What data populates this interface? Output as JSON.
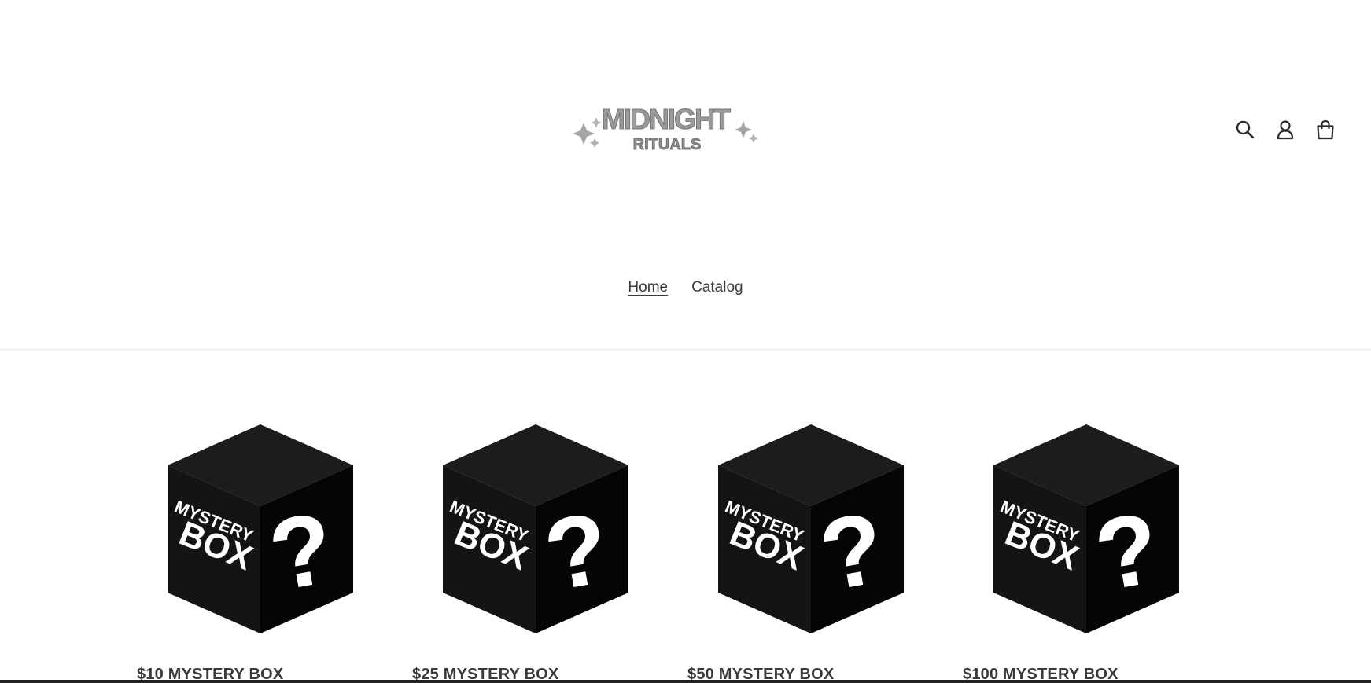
{
  "header": {
    "logo_text_top": "MIDNIGHT",
    "logo_text_bottom": "RITUALS",
    "icons": [
      "search-icon",
      "account-icon",
      "cart-icon"
    ]
  },
  "nav": {
    "items": [
      {
        "label": "Home",
        "active": true
      },
      {
        "label": "Catalog",
        "active": false
      }
    ]
  },
  "products": [
    {
      "title": "$10 MYSTERY BOX",
      "box_text_1": "MYSTERY",
      "box_text_2": "BOX",
      "box_symbol": "?"
    },
    {
      "title": "$25 MYSTERY BOX",
      "box_text_1": "MYSTERY",
      "box_text_2": "BOX",
      "box_symbol": "?"
    },
    {
      "title": "$50 MYSTERY BOX",
      "box_text_1": "MYSTERY",
      "box_text_2": "BOX",
      "box_symbol": "?"
    },
    {
      "title": "$100 MYSTERY BOX",
      "box_text_1": "MYSTERY",
      "box_text_2": "BOX",
      "box_symbol": "?"
    }
  ],
  "colors": {
    "text": "#3a3a3a",
    "box_top": "#1c1c1c",
    "box_left": "#141414",
    "box_right": "#050505",
    "logo_gray": "#9a9a9a"
  }
}
